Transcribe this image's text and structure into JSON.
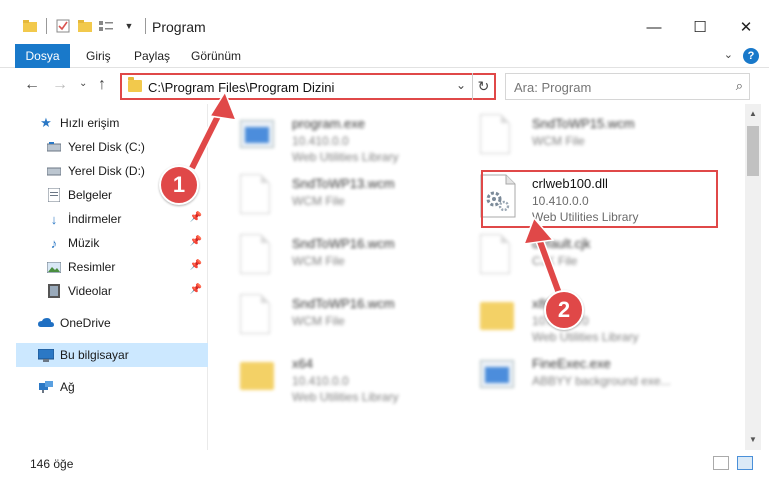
{
  "window": {
    "title": "Program",
    "minimize_icon": "minimize-icon",
    "maximize_icon": "maximize-icon",
    "close_icon": "close-icon"
  },
  "ribbon": {
    "tabs": [
      "Dosya",
      "Giriş",
      "Paylaş",
      "Görünüm"
    ],
    "help": "?"
  },
  "nav": {
    "address": "C:\\Program Files\\Program Dizini",
    "search_placeholder": "Ara: Program"
  },
  "sidebar": {
    "items": [
      {
        "label": "Hızlı erişim",
        "icon": "star-icon",
        "pinned": false
      },
      {
        "label": "Yerel Disk (C:)",
        "icon": "drive-icon",
        "pinned": false
      },
      {
        "label": "Yerel Disk (D:)",
        "icon": "drive-icon",
        "pinned": false
      },
      {
        "label": "Belgeler",
        "icon": "document-icon",
        "pinned": false
      },
      {
        "label": "İndirmeler",
        "icon": "download-icon",
        "pinned": true
      },
      {
        "label": "Müzik",
        "icon": "music-icon",
        "pinned": true
      },
      {
        "label": "Resimler",
        "icon": "image-icon",
        "pinned": true
      },
      {
        "label": "Videolar",
        "icon": "video-icon",
        "pinned": true
      },
      {
        "label": "OneDrive",
        "icon": "cloud-icon",
        "pinned": false
      },
      {
        "label": "Bu bilgisayar",
        "icon": "computer-icon",
        "pinned": false
      },
      {
        "label": "Ağ",
        "icon": "network-icon",
        "pinned": false
      }
    ]
  },
  "files": [
    {
      "name": "program.exe",
      "line1": "10.410.0.0",
      "line2": "Web Utilities Library",
      "icon": "exe-icon",
      "blurred": true
    },
    {
      "name": "SndToWP15.wcm",
      "line1": "WCM File",
      "line2": "",
      "icon": "doc-icon",
      "blurred": true
    },
    {
      "name": "SndToWP13.wcm",
      "line1": "WCM File",
      "line2": "",
      "icon": "doc-icon",
      "blurred": true
    },
    {
      "name": "crlweb100.dll",
      "line1": "10.410.0.0",
      "line2": "Web Utilities Library",
      "icon": "dll-icon",
      "blurred": false
    },
    {
      "name": "SndToWP16.wcm",
      "line1": "WCM File",
      "line2": "",
      "icon": "doc-icon",
      "blurred": true
    },
    {
      "name": "default.cjk",
      "line1": "CJK File",
      "line2": "",
      "icon": "doc-icon",
      "blurred": true
    },
    {
      "name": "SndToWP16.wcm",
      "line1": "WCM File",
      "line2": "",
      "icon": "doc-icon",
      "blurred": true
    },
    {
      "name": "x86",
      "line1": "10.410.0.0",
      "line2": "Web Utilities Library",
      "icon": "folder-icon",
      "blurred": true
    },
    {
      "name": "x64",
      "line1": "10.410.0.0",
      "line2": "Web Utilities Library",
      "icon": "folder-icon",
      "blurred": true
    },
    {
      "name": "FineExec.exe",
      "line1": "ABBYY background exe...",
      "line2": "",
      "icon": "exe-icon",
      "blurred": true
    }
  ],
  "status": {
    "count": "146 öğe"
  },
  "annotations": {
    "callout1": "1",
    "callout2": "2",
    "color": "#e04848"
  }
}
